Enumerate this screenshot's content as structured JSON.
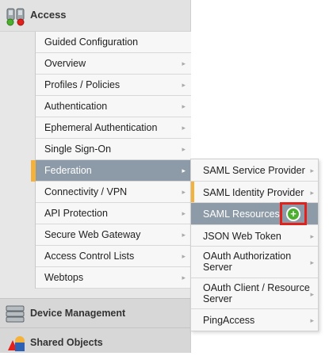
{
  "nav": {
    "access": {
      "label": "Access",
      "icon": "access-icon"
    },
    "submenu": [
      {
        "label": "Guided Configuration",
        "chevron": false
      },
      {
        "label": "Overview",
        "chevron": true
      },
      {
        "label": "Profiles / Policies",
        "chevron": true
      },
      {
        "label": "Authentication",
        "chevron": true
      },
      {
        "label": "Ephemeral Authentication",
        "chevron": true
      },
      {
        "label": "Single Sign-On",
        "chevron": true
      },
      {
        "label": "Federation",
        "chevron": true,
        "active": true
      },
      {
        "label": "Connectivity / VPN",
        "chevron": true
      },
      {
        "label": "API Protection",
        "chevron": true
      },
      {
        "label": "Secure Web Gateway",
        "chevron": true
      },
      {
        "label": "Access Control Lists",
        "chevron": true
      },
      {
        "label": "Webtops",
        "chevron": true
      }
    ],
    "sections": {
      "device_management": {
        "label": "Device Management",
        "icon": "server-icon"
      },
      "shared_objects": {
        "label": "Shared Objects",
        "icon": "shapes-icon"
      }
    }
  },
  "flyout": {
    "items": [
      {
        "label": "SAML Service Provider"
      },
      {
        "label": "SAML Identity Provider"
      },
      {
        "label": "SAML Resources"
      },
      {
        "label": "JSON Web Token"
      },
      {
        "label": "OAuth Authorization Server"
      },
      {
        "label": "OAuth Client / Resource Server"
      },
      {
        "label": "PingAccess"
      }
    ],
    "add_icon": "plus-circle-icon"
  },
  "colors": {
    "active_bg": "#8d9aa7",
    "active_marker": "#f5b23a",
    "highlight_border": "#e3211c",
    "add_green": "#4caf2e"
  }
}
